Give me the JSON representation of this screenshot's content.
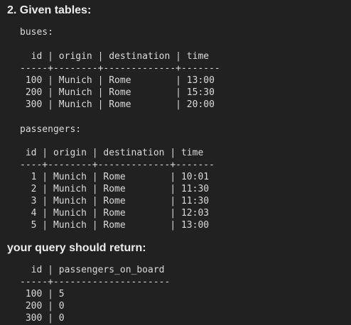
{
  "question_heading": "2. Given tables:",
  "buses": {
    "label": "buses:",
    "table_text": "  id | origin | destination | time\n-----+--------+-------------+-------\n 100 | Munich | Rome        | 13:00\n 200 | Munich | Rome        | 15:30\n 300 | Munich | Rome        | 20:00"
  },
  "passengers": {
    "label": "passengers:",
    "table_text": " id | origin | destination | time\n----+--------+-------------+-------\n  1 | Munich | Rome        | 10:01\n  2 | Munich | Rome        | 11:30\n  3 | Munich | Rome        | 11:30\n  4 | Munich | Rome        | 12:03\n  5 | Munich | Rome        | 13:00"
  },
  "result_heading": "your query should return:",
  "result": {
    "table_text": "  id | passengers_on_board\n-----+---------------------\n 100 | 5\n 200 | 0\n 300 | 0"
  }
}
